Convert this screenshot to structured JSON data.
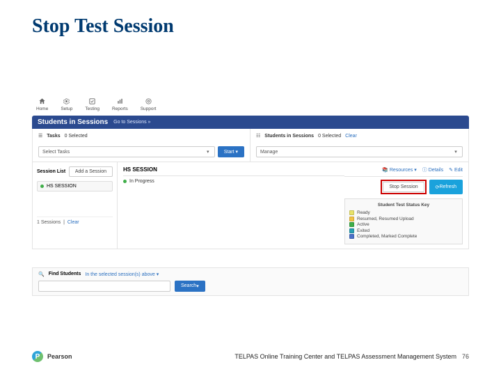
{
  "slide": {
    "title": "Stop Test Session"
  },
  "topnav": {
    "items": [
      {
        "label": "Home"
      },
      {
        "label": "Setup"
      },
      {
        "label": "Testing"
      },
      {
        "label": "Reports"
      },
      {
        "label": "Support"
      }
    ]
  },
  "header": {
    "title": "Students in Sessions",
    "go_link": "Go to Sessions »"
  },
  "tasks": {
    "label": "Tasks",
    "selected_text": "0 Selected",
    "select_label": "Select Tasks",
    "start_label": "Start"
  },
  "sessions_panel": {
    "label": "Students in Sessions",
    "selected_text": "0 Selected",
    "clear": "Clear",
    "manage": "Manage"
  },
  "session_list": {
    "title": "Session List",
    "add_button": "Add a Session",
    "item": "HS SESSION",
    "footer_count": "1 Sessions",
    "footer_clear": "Clear"
  },
  "detail": {
    "title": "HS SESSION",
    "progress": "In Progress",
    "top_links": {
      "resources": "Resources",
      "details": "Details",
      "edit": "Edit"
    },
    "stop_button": "Stop Session",
    "refresh_button": "Refresh"
  },
  "status_key": {
    "title": "Student Test Status Key",
    "items": [
      {
        "label": "Ready",
        "cls": "sw-ready"
      },
      {
        "label": "Resumed, Resumed Upload",
        "cls": "sw-resumed"
      },
      {
        "label": "Active",
        "cls": "sw-active"
      },
      {
        "label": "Exited",
        "cls": "sw-exited"
      },
      {
        "label": "Completed, Marked Complete",
        "cls": "sw-completed"
      }
    ]
  },
  "find": {
    "label": "Find Students",
    "scope": "In the selected session(s) above",
    "search_button": "Search"
  },
  "footer": {
    "brand": "Pearson",
    "caption": "TELPAS Online Training Center and TELPAS Assessment Management System",
    "page": "76"
  }
}
